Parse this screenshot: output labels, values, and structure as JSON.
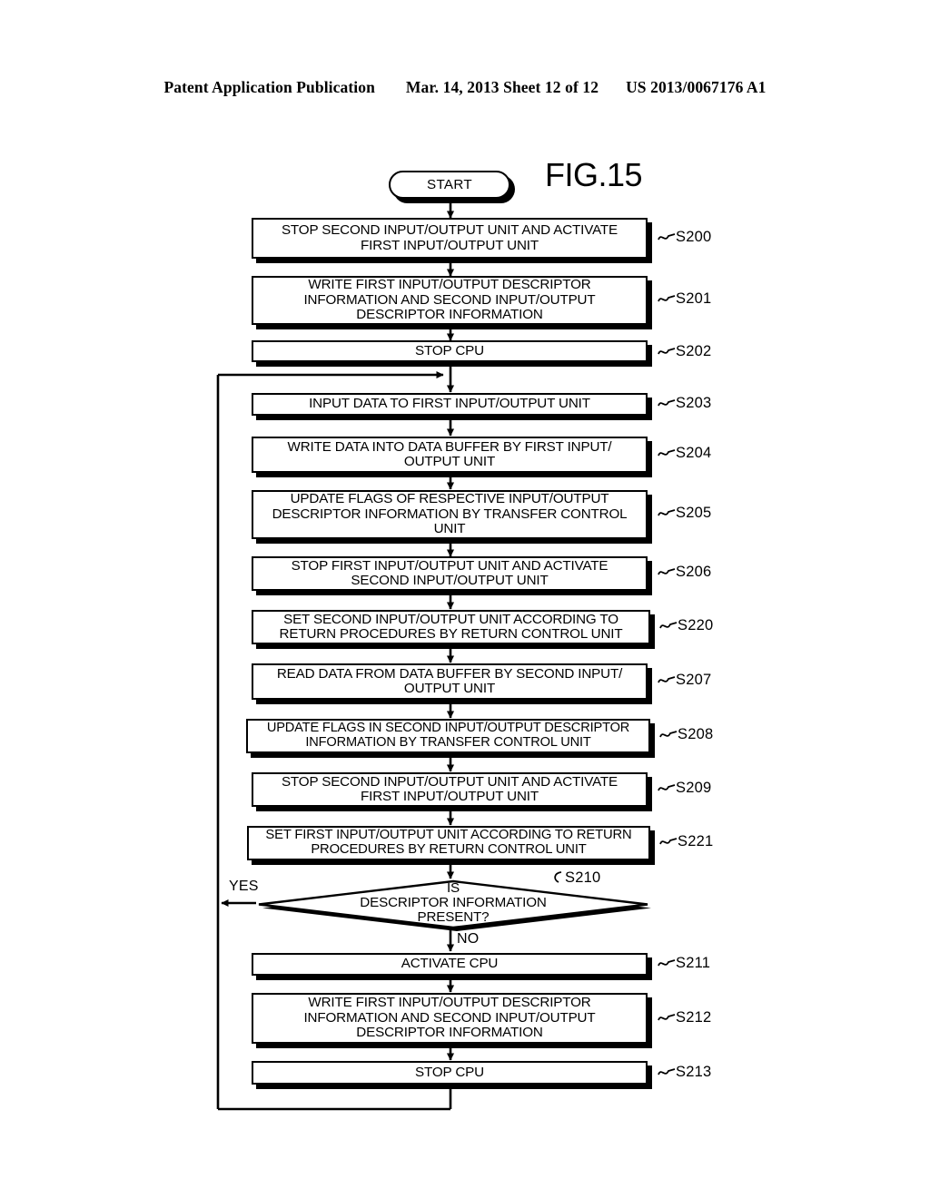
{
  "header": {
    "publication": "Patent Application Publication",
    "date_sheet": "Mar. 14, 2013  Sheet 12 of 12",
    "patent_number": "US 2013/0067176 A1"
  },
  "figure": {
    "title": "FIG.15",
    "type": "flowchart"
  },
  "terminal": {
    "start_label": "START"
  },
  "branch_labels": {
    "yes": "YES",
    "no": "NO"
  },
  "nodes": [
    {
      "id": "S200",
      "shape": "process",
      "text": "STOP SECOND INPUT/OUTPUT UNIT AND ACTIVATE\nFIRST INPUT/OUTPUT UNIT",
      "step": "S200"
    },
    {
      "id": "S201",
      "shape": "process",
      "text": "WRITE FIRST INPUT/OUTPUT DESCRIPTOR\nINFORMATION AND SECOND INPUT/OUTPUT\nDESCRIPTOR INFORMATION",
      "step": "S201"
    },
    {
      "id": "S202",
      "shape": "process",
      "text": "STOP CPU",
      "step": "S202"
    },
    {
      "id": "S203",
      "shape": "process",
      "text": "INPUT DATA TO FIRST INPUT/OUTPUT UNIT",
      "step": "S203"
    },
    {
      "id": "S204",
      "shape": "process",
      "text": "WRITE DATA INTO DATA BUFFER BY FIRST INPUT/\nOUTPUT UNIT",
      "step": "S204"
    },
    {
      "id": "S205",
      "shape": "process",
      "text": "UPDATE FLAGS OF RESPECTIVE INPUT/OUTPUT\nDESCRIPTOR INFORMATION BY TRANSFER CONTROL\nUNIT",
      "step": "S205"
    },
    {
      "id": "S206",
      "shape": "process",
      "text": "STOP FIRST INPUT/OUTPUT UNIT AND ACTIVATE\nSECOND INPUT/OUTPUT UNIT",
      "step": "S206"
    },
    {
      "id": "S220",
      "shape": "process",
      "text": "SET SECOND INPUT/OUTPUT UNIT ACCORDING TO\nRETURN PROCEDURES BY RETURN CONTROL UNIT",
      "step": "S220"
    },
    {
      "id": "S207",
      "shape": "process",
      "text": "READ DATA FROM DATA BUFFER BY SECOND INPUT/\nOUTPUT UNIT",
      "step": "S207"
    },
    {
      "id": "S208",
      "shape": "process",
      "text": "UPDATE FLAGS IN SECOND INPUT/OUTPUT DESCRIPTOR\nINFORMATION BY TRANSFER CONTROL UNIT",
      "step": "S208"
    },
    {
      "id": "S209",
      "shape": "process",
      "text": "STOP SECOND INPUT/OUTPUT UNIT AND ACTIVATE\nFIRST INPUT/OUTPUT UNIT",
      "step": "S209"
    },
    {
      "id": "S221",
      "shape": "process",
      "text": "SET FIRST INPUT/OUTPUT UNIT ACCORDING TO RETURN\nPROCEDURES BY RETURN CONTROL UNIT",
      "step": "S221"
    },
    {
      "id": "S210",
      "shape": "decision",
      "text": "IS\nDESCRIPTOR INFORMATION\nPRESENT?",
      "step": "S210"
    },
    {
      "id": "S211",
      "shape": "process",
      "text": "ACTIVATE CPU",
      "step": "S211"
    },
    {
      "id": "S212",
      "shape": "process",
      "text": "WRITE FIRST INPUT/OUTPUT DESCRIPTOR\nINFORMATION AND SECOND INPUT/OUTPUT\nDESCRIPTOR INFORMATION",
      "step": "S212"
    },
    {
      "id": "S213",
      "shape": "process",
      "text": "STOP CPU",
      "step": "S213"
    }
  ],
  "edges": [
    {
      "from": "START",
      "to": "S200",
      "label": ""
    },
    {
      "from": "S200",
      "to": "S201",
      "label": ""
    },
    {
      "from": "S201",
      "to": "S202",
      "label": ""
    },
    {
      "from": "S202",
      "to": "S203",
      "label": ""
    },
    {
      "from": "S203",
      "to": "S204",
      "label": ""
    },
    {
      "from": "S204",
      "to": "S205",
      "label": ""
    },
    {
      "from": "S205",
      "to": "S206",
      "label": ""
    },
    {
      "from": "S206",
      "to": "S220",
      "label": ""
    },
    {
      "from": "S220",
      "to": "S207",
      "label": ""
    },
    {
      "from": "S207",
      "to": "S208",
      "label": ""
    },
    {
      "from": "S208",
      "to": "S209",
      "label": ""
    },
    {
      "from": "S209",
      "to": "S221",
      "label": ""
    },
    {
      "from": "S221",
      "to": "S210",
      "label": ""
    },
    {
      "from": "S210",
      "to": "S203",
      "label": "YES"
    },
    {
      "from": "S210",
      "to": "S211",
      "label": "NO"
    },
    {
      "from": "S211",
      "to": "S212",
      "label": ""
    },
    {
      "from": "S212",
      "to": "S213",
      "label": ""
    },
    {
      "from": "S213",
      "to": "S203",
      "label": ""
    }
  ],
  "colors": {
    "ink": "#000000",
    "paper": "#ffffff"
  }
}
